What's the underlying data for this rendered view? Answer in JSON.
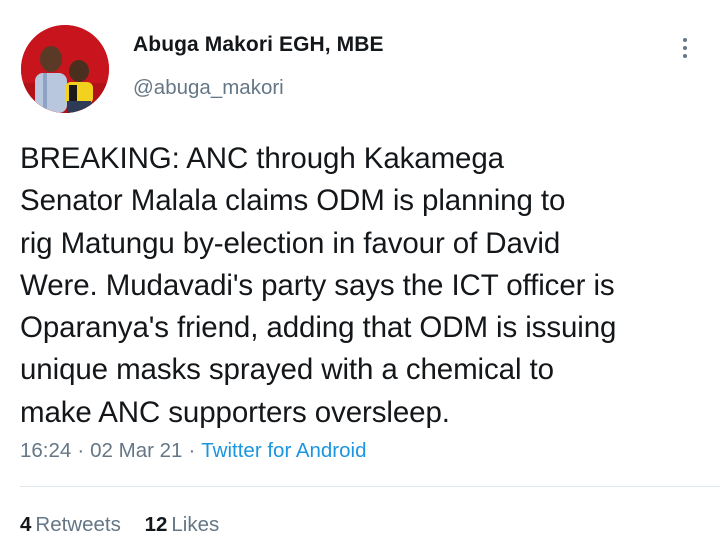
{
  "user": {
    "display_name": "Abuga Makori EGH, MBE",
    "handle": "@abuga_makori",
    "avatar_icon": "profile-photo"
  },
  "more_icon": "vertical-ellipsis-icon",
  "tweet": {
    "lines": [
      "BREAKING: ANC through Kakamega",
      "Senator Malala claims ODM is planning to",
      "rig Matungu by-election in favour of David",
      "Were. Mudavadi's party says the ICT officer is",
      "Oparanya's friend, adding that ODM is issuing",
      "unique masks sprayed with a chemical to",
      "make ANC supporters oversleep."
    ]
  },
  "meta": {
    "time": "16:24",
    "separator": "·",
    "date": "02 Mar 21",
    "source": "Twitter for Android"
  },
  "stats": {
    "retweets_count": "4",
    "retweets_label": "Retweets",
    "likes_count": "12",
    "likes_label": "Likes"
  },
  "colors": {
    "text": "#14171a",
    "secondary": "#657786",
    "link": "#1b95e0",
    "divider": "#e1e8ed",
    "avatar_bg": "#c8141c"
  }
}
